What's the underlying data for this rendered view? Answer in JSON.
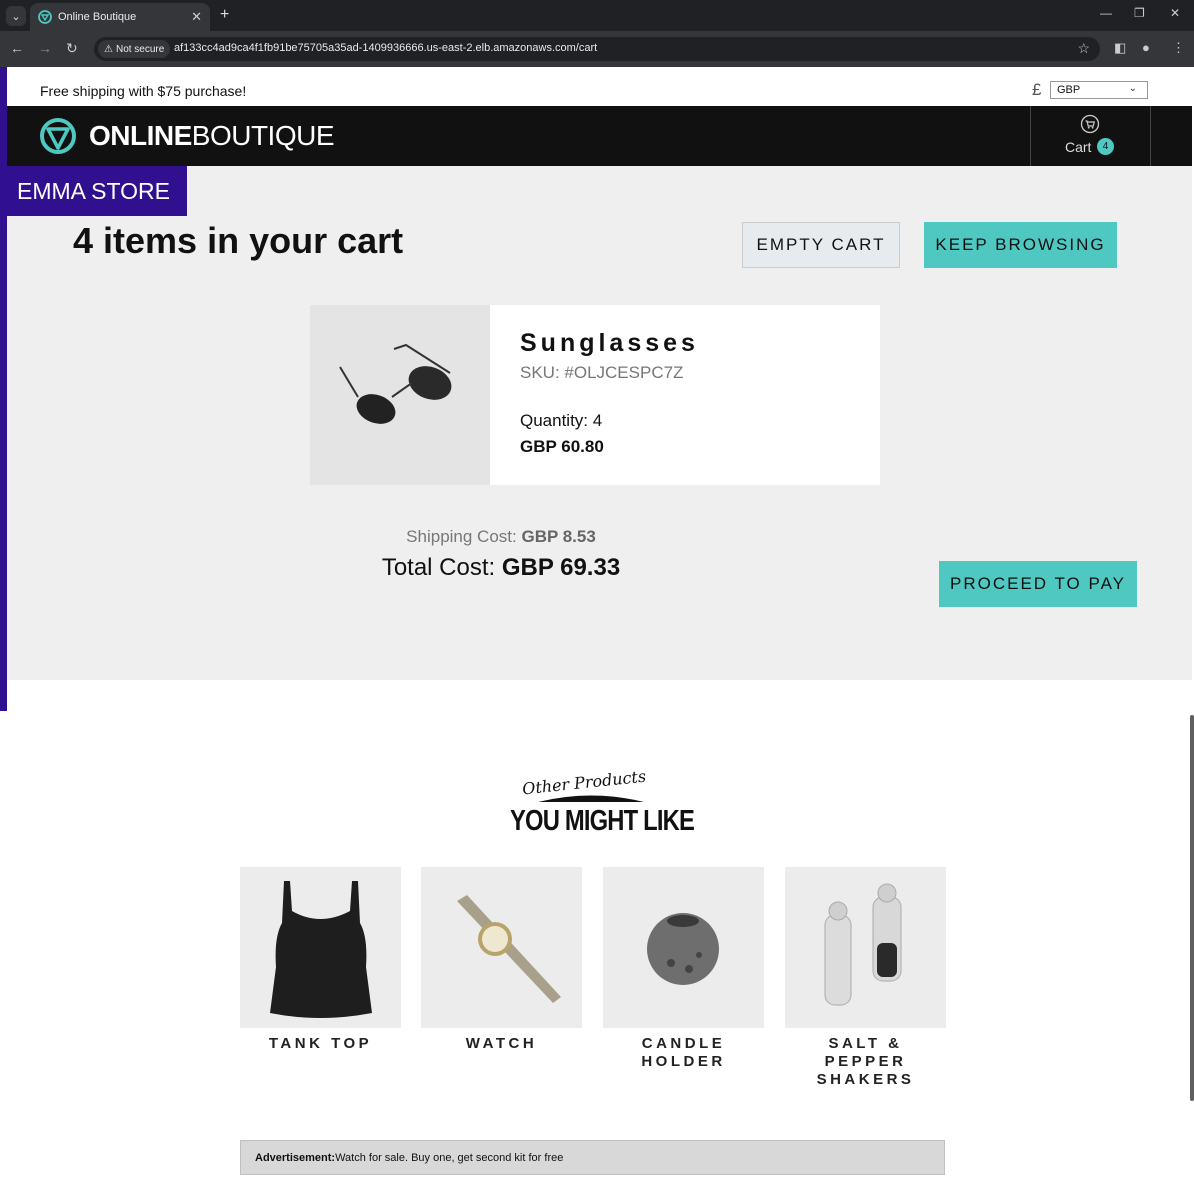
{
  "browser": {
    "tab_title": "Online Boutique",
    "not_secure_label": "Not secure",
    "url": "af133cc4ad9ca4f1fb91be75705a35ad-1409936666.us-east-2.elb.amazonaws.com/cart"
  },
  "header": {
    "promo_text": "Free shipping with $75 purchase!",
    "currency_symbol": "£",
    "currency_selected": "GBP",
    "logo_bold": "ONLINE",
    "logo_light": "BOUTIQUE",
    "cart_label": "Cart",
    "cart_count": "4"
  },
  "store_badge": "EMMA STORE",
  "cart": {
    "heading": "4 items in your cart",
    "empty_cart_label": "EMPTY CART",
    "keep_browsing_label": "KEEP BROWSING",
    "items": [
      {
        "name": "Sunglasses",
        "sku": "SKU: #OLJCESPC7Z",
        "quantity": "Quantity: 4",
        "price": "GBP 60.80"
      }
    ],
    "shipping_label": "Shipping Cost: ",
    "shipping_value": "GBP 8.53",
    "total_label": "Total Cost: ",
    "total_value": "GBP 69.33",
    "proceed_label": "PROCEED TO PAY"
  },
  "recommendations": {
    "title_script": "Other Products",
    "title_main": "YOU MIGHT LIKE",
    "items": [
      {
        "name": "TANK TOP"
      },
      {
        "name": "WATCH"
      },
      {
        "name": "CANDLE HOLDER"
      },
      {
        "name": "SALT & PEPPER SHAKERS"
      }
    ]
  },
  "ad": {
    "label": "Advertisement:",
    "text": " Watch for sale. Buy one, get second kit for free"
  },
  "colors": {
    "accent_teal": "#4fc8c2",
    "store_purple": "#30108e",
    "navbar_black": "#111111",
    "cart_bg": "#efefef"
  }
}
